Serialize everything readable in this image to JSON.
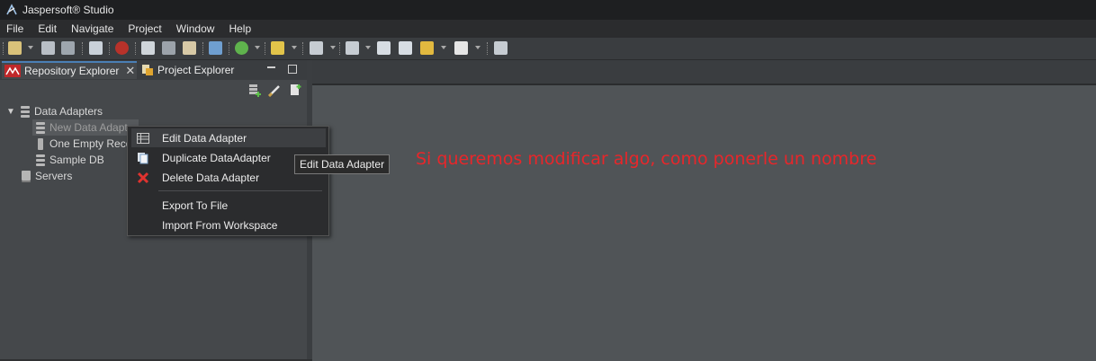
{
  "window": {
    "title": "Jaspersoft® Studio"
  },
  "menu": [
    "File",
    "Edit",
    "Navigate",
    "Project",
    "Window",
    "Help"
  ],
  "tabs": {
    "repository": "Repository Explorer",
    "project": "Project Explorer"
  },
  "tree": {
    "data_adapters": "Data Adapters",
    "new_data_adapter": "New Data Adapt",
    "one_empty_record": "One Empty Reco",
    "sample_db": "Sample DB",
    "servers": "Servers"
  },
  "context_menu": {
    "edit": "Edit Data Adapter",
    "duplicate": "Duplicate DataAdapter",
    "delete": "Delete Data Adapter",
    "export": "Export To File",
    "import": "Import From Workspace"
  },
  "tooltip": "Edit Data Adapter",
  "annotation": "Si queremos modificar algo, como ponerle un nombre",
  "colors": {
    "accent_tab": "#4a7fb5",
    "annotation": "#e8262a",
    "delete_icon": "#e0332f"
  }
}
